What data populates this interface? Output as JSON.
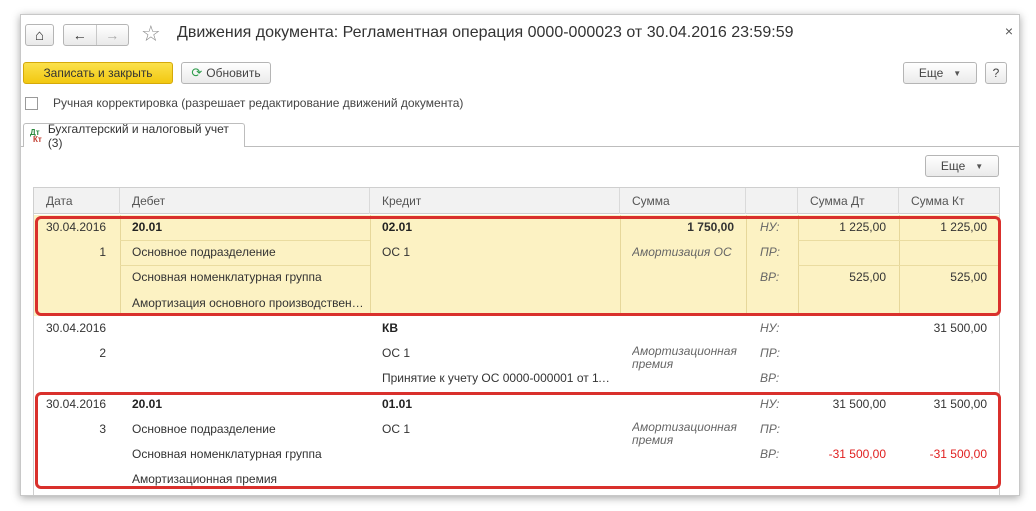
{
  "window": {
    "title": "Движения документа: Регламентная операция 0000-000023 от 30.04.2016 23:59:59",
    "close_glyph": "×",
    "home_glyph": "⌂",
    "back_glyph": "←",
    "forward_glyph": "→",
    "star_glyph": "☆"
  },
  "toolbar": {
    "save_close_label": "Записать и закрыть",
    "refresh_label": "Обновить",
    "more_label": "Еще",
    "help_label": "?"
  },
  "manual_edit": {
    "checked": false,
    "label": "Ручная корректировка (разрешает редактирование движений документа)"
  },
  "tab": {
    "label": "Бухгалтерский и налоговый учет (3)",
    "icon_top": "Дт",
    "icon_bottom": "Кт"
  },
  "grid": {
    "more_label": "Еще",
    "columns": [
      "Дата",
      "Дебет",
      "Кредит",
      "Сумма",
      "",
      "Сумма Дт",
      "Сумма Кт"
    ],
    "rows": [
      {
        "date": "30.04.2016",
        "num": "1",
        "debet": [
          "20.01",
          "Основное подразделение",
          "Основная номенклатурная группа",
          "Амортизация основного производственн..."
        ],
        "kredit": [
          "02.01",
          "ОС 1",
          ""
        ],
        "summa": "1 750,00",
        "content": "Амортизация ОС",
        "types": [
          "НУ:",
          "ПР:",
          "ВР:"
        ],
        "summa_dt": [
          "1 225,00",
          "",
          "525,00"
        ],
        "summa_kt": [
          "1 225,00",
          "",
          "525,00"
        ]
      },
      {
        "date": "30.04.2016",
        "num": "2",
        "debet": [
          "",
          "",
          "",
          ""
        ],
        "kredit": [
          "КВ",
          "ОС 1",
          "Принятие к учету ОС 0000-000001 от 11...."
        ],
        "summa": "",
        "content": "Амортизационная премия",
        "types": [
          "НУ:",
          "ПР:",
          "ВР:"
        ],
        "summa_dt": [
          "",
          "",
          ""
        ],
        "summa_kt": [
          "31 500,00",
          "",
          ""
        ]
      },
      {
        "date": "30.04.2016",
        "num": "3",
        "debet": [
          "20.01",
          "Основное подразделение",
          "Основная номенклатурная группа",
          "Амортизационная премия"
        ],
        "kredit": [
          "01.01",
          "ОС 1",
          ""
        ],
        "summa": "",
        "content": "Амортизационная премия",
        "types": [
          "НУ:",
          "ПР:",
          "ВР:"
        ],
        "summa_dt": [
          "31 500,00",
          "",
          "-31 500,00"
        ],
        "summa_kt": [
          "31 500,00",
          "",
          "-31 500,00"
        ]
      }
    ]
  },
  "colors": {
    "primary_button": "#f2c811",
    "selected_row": "#fcf2c3",
    "highlight_frame": "#d9302c",
    "negative": "#e02020"
  }
}
